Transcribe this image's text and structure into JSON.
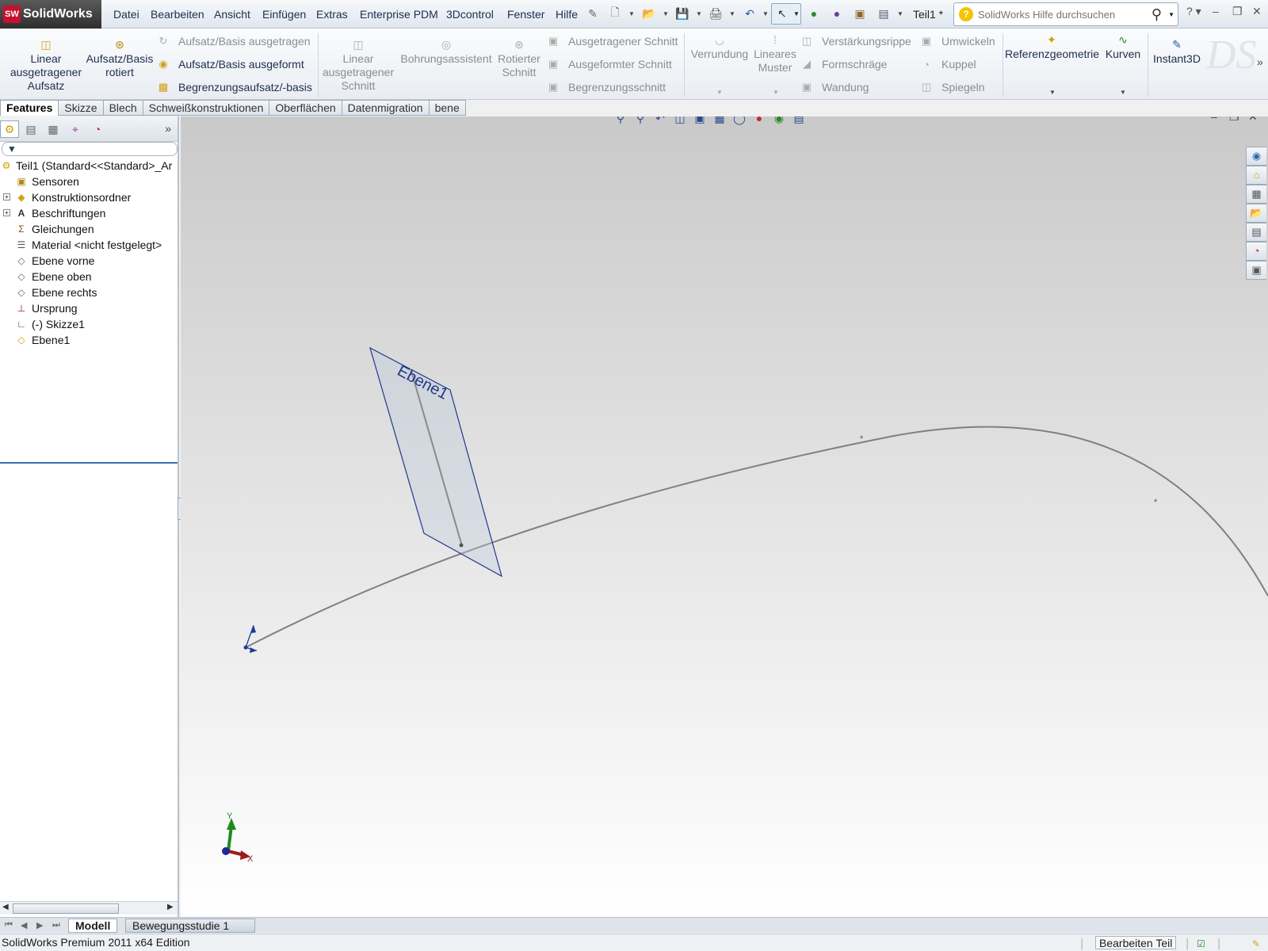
{
  "app": {
    "brand": "SolidWorks",
    "brand_badge": "SW",
    "document_title": "Teil1 *"
  },
  "menu": [
    "Datei",
    "Bearbeiten",
    "Ansicht",
    "Einfügen",
    "Extras",
    "Enterprise PDM",
    "3Dcontrol",
    "Fenster",
    "Hilfe"
  ],
  "search": {
    "placeholder": "SolidWorks Hilfe durchsuchen"
  },
  "ribbon": {
    "linear_extrude": "Linear ausgetragener Aufsatz",
    "revolve": "Aufsatz/Basis rotiert",
    "sweep": "Aufsatz/Basis ausgetragen",
    "loft": "Aufsatz/Basis ausgeformt",
    "boundary": "Begrenzungsaufsatz/-basis",
    "extruded_cut": "Linear ausgetragener Schnitt",
    "hole_wizard": "Bohrungsassistent",
    "revolved_cut": "Rotierter Schnitt",
    "swept_cut": "Ausgetragener Schnitt",
    "lofted_cut": "Ausgeformter Schnitt",
    "boundary_cut": "Begrenzungsschnitt",
    "fillet": "Verrundung",
    "linear_pattern": "Lineares Muster",
    "rib": "Verstärkungsrippe",
    "draft": "Formschräge",
    "shell": "Wandung",
    "wrap": "Umwickeln",
    "dome": "Kuppel",
    "mirror": "Spiegeln",
    "ref_geometry": "Referenzgeometrie",
    "curves": "Kurven",
    "instant3d": "Instant3D"
  },
  "command_tabs": [
    "Features",
    "Skizze",
    "Blech",
    "Schweißkonstruktionen",
    "Oberflächen",
    "Datenmigration",
    "bene"
  ],
  "tree": {
    "root": "Teil1  (Standard<<Standard>_Ar",
    "items": [
      {
        "label": "Sensoren",
        "icon": "sensor-icon",
        "expandable": false
      },
      {
        "label": "Konstruktionsordner",
        "icon": "design-binder-icon",
        "expandable": true
      },
      {
        "label": "Beschriftungen",
        "icon": "annotations-icon",
        "expandable": true
      },
      {
        "label": "Gleichungen",
        "icon": "equations-icon",
        "expandable": false
      },
      {
        "label": "Material <nicht festgelegt>",
        "icon": "material-icon",
        "expandable": false
      },
      {
        "label": "Ebene vorne",
        "icon": "plane-icon",
        "expandable": false
      },
      {
        "label": "Ebene oben",
        "icon": "plane-icon",
        "expandable": false
      },
      {
        "label": "Ebene rechts",
        "icon": "plane-icon",
        "expandable": false
      },
      {
        "label": "Ursprung",
        "icon": "origin-icon",
        "expandable": false
      },
      {
        "label": "(-) Skizze1",
        "icon": "sketch-icon",
        "expandable": false
      },
      {
        "label": "Ebene1",
        "icon": "plane-icon",
        "expandable": false
      }
    ]
  },
  "viewport": {
    "plane_label": "Ebene1",
    "triad_x": "X",
    "triad_y": "Y",
    "curve_color": "#808080",
    "plane_outline_color": "#1f3a8a"
  },
  "bottom_tabs": [
    "Modell",
    "Bewegungsstudie 1"
  ],
  "status": {
    "edition": "SolidWorks Premium 2011 x64 Edition",
    "mode": "Bearbeiten Teil"
  }
}
